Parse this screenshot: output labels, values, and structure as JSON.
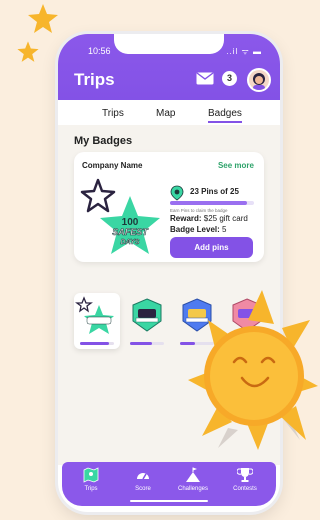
{
  "status_bar": {
    "time": "10:56",
    "icons": "..il ᯤ ▬"
  },
  "app": {
    "title": "Trips",
    "notification_count": "3"
  },
  "tabs": [
    {
      "label": "Trips",
      "active": false
    },
    {
      "label": "Map",
      "active": false
    },
    {
      "label": "Badges",
      "active": true
    }
  ],
  "my_badges": {
    "title": "My Badges",
    "card": {
      "company": "Company Name",
      "see_more": "See more",
      "pins_text": "23 Pins of  25",
      "pins_earned": 23,
      "pins_total": 25,
      "earn_hint": "Earn Pins to claim the badge",
      "reward_label": "Reward:",
      "reward_value": " $25 gift card",
      "level_label": "Badge Level:",
      "level_value": " 5",
      "add_button": "Add pins",
      "badge_art": {
        "line1": "100",
        "line2": "SAFEST",
        "line3": "DAYS"
      }
    },
    "mini_badges": [
      {
        "icon": "safest-days-badge",
        "progress": 0.85,
        "selected": true
      },
      {
        "icon": "teal-shield-badge",
        "progress": 0.65,
        "selected": false
      },
      {
        "icon": "blue-shield-badge",
        "progress": 0.45,
        "selected": false
      },
      {
        "icon": "pink-shield-badge",
        "progress": 0.3,
        "selected": false
      }
    ]
  },
  "bottom_nav": [
    {
      "label": "Trips",
      "icon": "map-icon",
      "active": true
    },
    {
      "label": "Score",
      "icon": "gauge-icon",
      "active": false
    },
    {
      "label": "Challenges",
      "icon": "flag-mountain-icon",
      "active": false
    },
    {
      "label": "Contests",
      "icon": "trophy-icon",
      "active": false
    }
  ],
  "colors": {
    "primary": "#8352e6",
    "accent_green": "#2fa36b",
    "badge_teal": "#3ad6a3",
    "background": "#fbeede",
    "sun": "#f7a928"
  }
}
